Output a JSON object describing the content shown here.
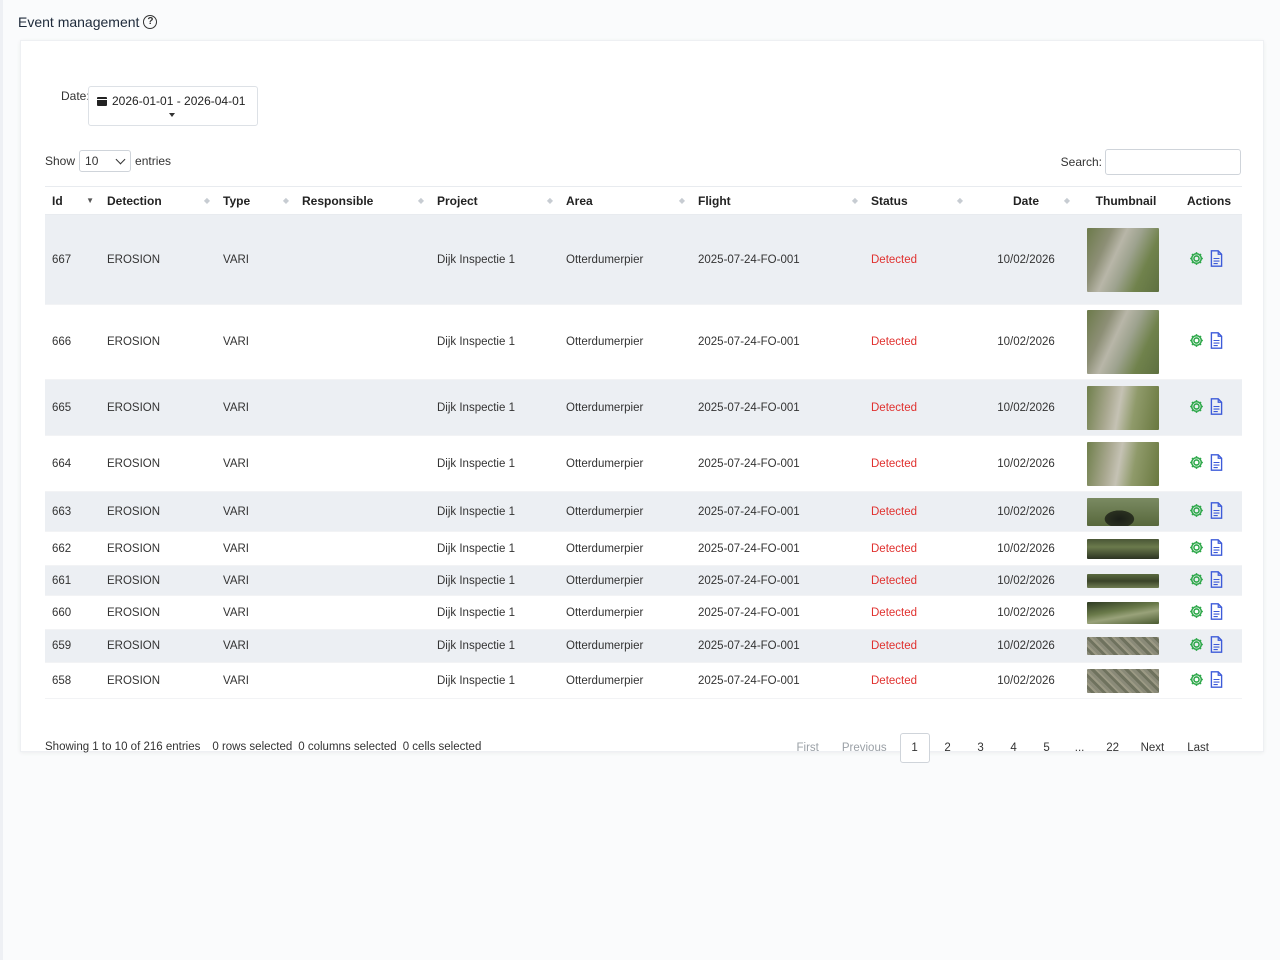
{
  "page": {
    "title": "Event management",
    "help_glyph": "?"
  },
  "filters": {
    "date_label": "Date:",
    "date_range": "2026-01-01 - 2026-04-01"
  },
  "length": {
    "show_label": "Show",
    "value": "10",
    "entries_label": "entries"
  },
  "search": {
    "label": "Search:",
    "value": ""
  },
  "table": {
    "columns": [
      "Id",
      "Detection",
      "Type",
      "Responsible",
      "Project",
      "Area",
      "Flight",
      "Status",
      "Date",
      "Thumbnail",
      "Actions"
    ],
    "rows": [
      {
        "id": "667",
        "detection": "EROSION",
        "type": "VARI",
        "responsible": "",
        "project": "Dijk Inspectie 1",
        "area": "Otterdumerpier",
        "flight": "2025-07-24-FO-001",
        "status": "Detected",
        "date": "10/02/2026",
        "thumb": "grass"
      },
      {
        "id": "666",
        "detection": "EROSION",
        "type": "VARI",
        "responsible": "",
        "project": "Dijk Inspectie 1",
        "area": "Otterdumerpier",
        "flight": "2025-07-24-FO-001",
        "status": "Detected",
        "date": "10/02/2026",
        "thumb": "grass"
      },
      {
        "id": "665",
        "detection": "EROSION",
        "type": "VARI",
        "responsible": "",
        "project": "Dijk Inspectie 1",
        "area": "Otterdumerpier",
        "flight": "2025-07-24-FO-001",
        "status": "Detected",
        "date": "10/02/2026",
        "thumb": "grass2"
      },
      {
        "id": "664",
        "detection": "EROSION",
        "type": "VARI",
        "responsible": "",
        "project": "Dijk Inspectie 1",
        "area": "Otterdumerpier",
        "flight": "2025-07-24-FO-001",
        "status": "Detected",
        "date": "10/02/2026",
        "thumb": "grass2"
      },
      {
        "id": "663",
        "detection": "EROSION",
        "type": "VARI",
        "responsible": "",
        "project": "Dijk Inspectie 1",
        "area": "Otterdumerpier",
        "flight": "2025-07-24-FO-001",
        "status": "Detected",
        "date": "10/02/2026",
        "thumb": "arch"
      },
      {
        "id": "662",
        "detection": "EROSION",
        "type": "VARI",
        "responsible": "",
        "project": "Dijk Inspectie 1",
        "area": "Otterdumerpier",
        "flight": "2025-07-24-FO-001",
        "status": "Detected",
        "date": "10/02/2026",
        "thumb": "dark"
      },
      {
        "id": "661",
        "detection": "EROSION",
        "type": "VARI",
        "responsible": "",
        "project": "Dijk Inspectie 1",
        "area": "Otterdumerpier",
        "flight": "2025-07-24-FO-001",
        "status": "Detected",
        "date": "10/02/2026",
        "thumb": "strip"
      },
      {
        "id": "660",
        "detection": "EROSION",
        "type": "VARI",
        "responsible": "",
        "project": "Dijk Inspectie 1",
        "area": "Otterdumerpier",
        "flight": "2025-07-24-FO-001",
        "status": "Detected",
        "date": "10/02/2026",
        "thumb": "ditch"
      },
      {
        "id": "659",
        "detection": "EROSION",
        "type": "VARI",
        "responsible": "",
        "project": "Dijk Inspectie 1",
        "area": "Otterdumerpier",
        "flight": "2025-07-24-FO-001",
        "status": "Detected",
        "date": "10/02/2026",
        "thumb": "gravel"
      },
      {
        "id": "658",
        "detection": "EROSION",
        "type": "VARI",
        "responsible": "",
        "project": "Dijk Inspectie 1",
        "area": "Otterdumerpier",
        "flight": "2025-07-24-FO-001",
        "status": "Detected",
        "date": "10/02/2026",
        "thumb": "gravel"
      }
    ]
  },
  "footer": {
    "showing": "Showing 1 to 10 of 216 entries",
    "rows_selected": "0 rows selected",
    "columns_selected": "0 columns selected",
    "cells_selected": "0 cells selected"
  },
  "pagination": {
    "first": "First",
    "previous": "Previous",
    "pages": [
      "1",
      "2",
      "3",
      "4",
      "5",
      "...",
      "22"
    ],
    "current": "1",
    "next": "Next",
    "last": "Last"
  },
  "colors": {
    "status_detected": "#e0312f",
    "gear_icon": "#2ea84a",
    "doc_icon": "#3d5bd9",
    "row_stripe": "#eceff3"
  },
  "icons": {
    "action_settings": "gear-icon",
    "action_report": "document-icon",
    "date_picker": "calendar-icon"
  }
}
